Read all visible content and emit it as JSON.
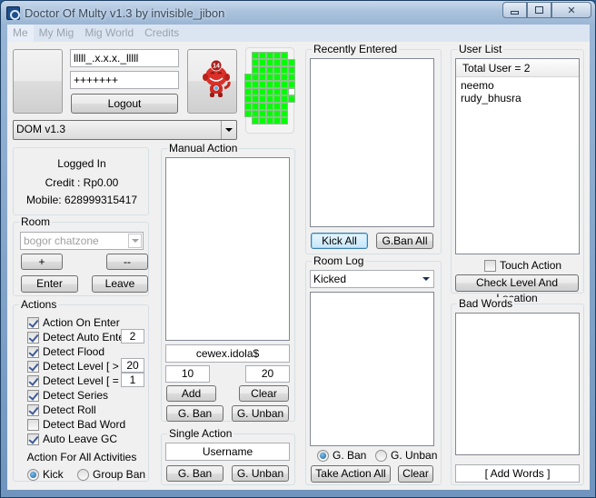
{
  "window": {
    "title": "Doctor Of Multy v1.3 by invisible_jibon",
    "icon": "app-icon",
    "controls": [
      "minimize-icon",
      "maximize-icon",
      "close-icon"
    ]
  },
  "menu": [
    "Me",
    "My Mig",
    "Mig World",
    "Credits"
  ],
  "login": {
    "username": "lllll_.x.x.x._lllll",
    "password": "+++++++",
    "logout_label": "Logout",
    "profile_dropdown": "DOM v1.3",
    "mascot_badge": "14"
  },
  "status_grid": {
    "colors": {
      "on": "#00ff00",
      "off": "#ffffff"
    },
    "rows": [
      [
        0,
        1,
        1,
        1,
        1,
        1,
        0
      ],
      [
        0,
        1,
        1,
        1,
        1,
        1,
        1
      ],
      [
        0,
        1,
        1,
        1,
        1,
        1,
        1
      ],
      [
        1,
        1,
        1,
        1,
        1,
        1,
        1
      ],
      [
        1,
        1,
        1,
        1,
        1,
        1,
        1
      ],
      [
        1,
        1,
        1,
        1,
        1,
        1,
        2
      ],
      [
        1,
        1,
        1,
        1,
        1,
        1,
        1
      ],
      [
        1,
        1,
        1,
        1,
        1,
        1,
        0
      ],
      [
        1,
        1,
        1,
        1,
        1,
        1,
        0
      ],
      [
        0,
        1,
        1,
        1,
        1,
        1,
        0
      ]
    ]
  },
  "account": {
    "status": "Logged In",
    "credit": "Credit : Rp0.00",
    "mobile": "Mobile: 628999315417"
  },
  "room": {
    "label": "Room",
    "selected": "bogor chatzone",
    "add_label": "+",
    "remove_label": "--",
    "enter_label": "Enter",
    "leave_label": "Leave"
  },
  "actions": {
    "label": "Actions",
    "items": [
      {
        "label": "Action On Enter",
        "checked": true,
        "value": null
      },
      {
        "label": "Detect Auto Enter",
        "checked": true,
        "value": "2"
      },
      {
        "label": "Detect Flood",
        "checked": true,
        "value": null
      },
      {
        "label": "Detect Level [ > ]",
        "checked": true,
        "value": "20"
      },
      {
        "label": "Detect Level [ = ]",
        "checked": true,
        "value": "1"
      },
      {
        "label": "Detect Series",
        "checked": true,
        "value": null
      },
      {
        "label": "Detect Roll",
        "checked": true,
        "value": null
      },
      {
        "label": "Detect Bad Word",
        "checked": false,
        "value": null
      },
      {
        "label": "Auto Leave GC",
        "checked": true,
        "value": null
      }
    ],
    "all_activities_label": "Action For All Activities",
    "radio_kick": "Kick",
    "radio_group_ban": "Group Ban",
    "selected": "Kick"
  },
  "manual_action": {
    "label": "Manual Action",
    "target": "cewex.idola$",
    "from": "10",
    "to": "20",
    "add_label": "Add",
    "clear_label": "Clear",
    "gban_label": "G. Ban",
    "gunban_label": "G. Unban"
  },
  "single_action": {
    "label": "Single Action",
    "username": "Username",
    "gban_label": "G. Ban",
    "gunban_label": "G. Unban"
  },
  "recently_entered": {
    "label": "Recently Entered",
    "kick_all_label": "Kick All",
    "gban_all_label": "G.Ban All"
  },
  "room_log": {
    "label": "Room Log",
    "filter": "Kicked",
    "radio_gban": "G. Ban",
    "radio_gunban": "G. Unban",
    "selected": "G. Ban",
    "take_action_label": "Take Action All",
    "clear_label": "Clear"
  },
  "user_list": {
    "label": "User List",
    "header": "Total User = 2",
    "users": [
      "neemo",
      "rudy_bhusra"
    ],
    "touch_action_label": "Touch Action",
    "touch_action_checked": false,
    "check_label": "Check Level And Location"
  },
  "bad_words": {
    "label": "Bad Words",
    "add_label": "[ Add Words ]"
  }
}
